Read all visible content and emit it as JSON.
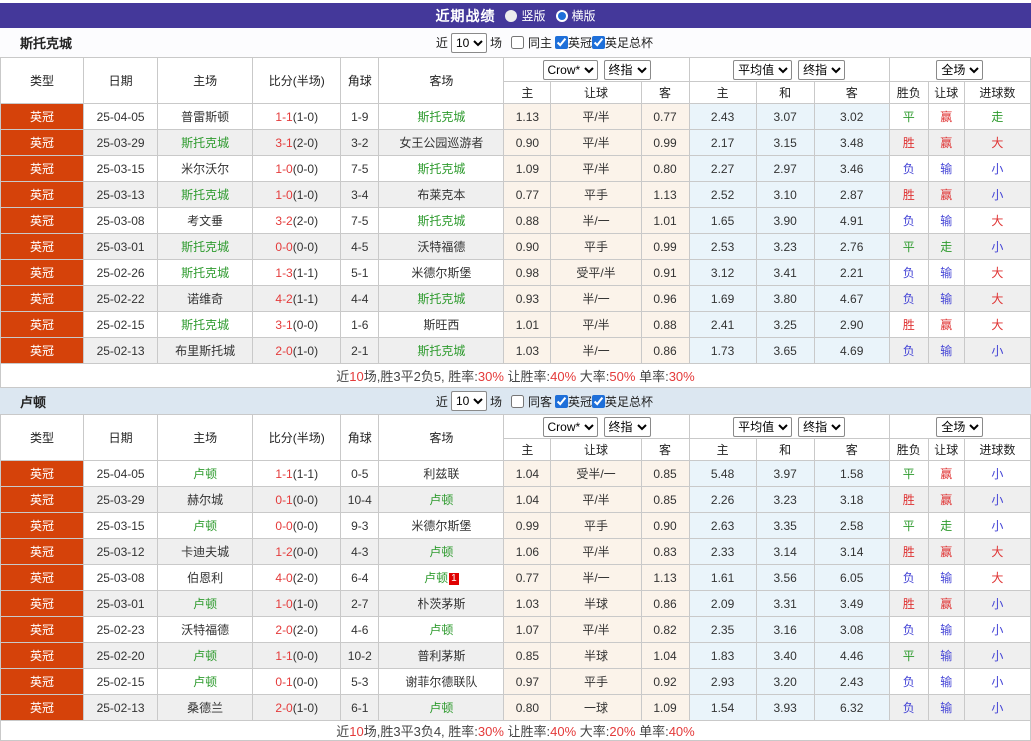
{
  "title_bar": {
    "title": "近期战绩",
    "options": [
      {
        "label": "竖版",
        "selected": false
      },
      {
        "label": "横版",
        "selected": true
      }
    ]
  },
  "table_head": {
    "cols": [
      "类型",
      "日期",
      "主场",
      "比分(半场)",
      "角球",
      "客场"
    ],
    "sub": [
      "主",
      "让球",
      "客",
      "主",
      "和",
      "客",
      "胜负",
      "让球",
      "进球数"
    ],
    "selects": {
      "book": "Crow*",
      "final1": "终指",
      "avg": "平均值",
      "final2": "终指",
      "full": "全场"
    }
  },
  "colors": {
    "accent": "#44389A",
    "league_badge": "#D5420A",
    "win_red": "#DF3232",
    "draw_green": "#2E9B2E",
    "lose_blue": "#4444D6",
    "handicap_bg": "#FBF3EA",
    "average_bg": "#EAF4FA"
  },
  "sections": [
    {
      "team": "斯托克城",
      "filter": {
        "near": "近",
        "count": "10",
        "unit": "场",
        "same": "同主",
        "same_checked": false,
        "leagues": [
          {
            "label": "英冠",
            "checked": true
          },
          {
            "label": "英足总杯",
            "checked": true
          }
        ]
      },
      "rows": [
        {
          "league": "英冠",
          "date": "25-04-05",
          "home": "普雷斯顿",
          "home_hl": false,
          "score": "1-1",
          "half": "(1-0)",
          "corner": "1-9",
          "away": "斯托克城",
          "away_hl": true,
          "odds": [
            "1.13",
            "平/半",
            "0.77"
          ],
          "europe": [
            "2.43",
            "3.07",
            "3.02"
          ],
          "results": [
            "平",
            "赢",
            "走"
          ]
        },
        {
          "league": "英冠",
          "date": "25-03-29",
          "home": "斯托克城",
          "home_hl": true,
          "score": "3-1",
          "half": "(2-0)",
          "corner": "3-2",
          "away": "女王公园巡游者",
          "away_hl": false,
          "odds": [
            "0.90",
            "平/半",
            "0.99"
          ],
          "europe": [
            "2.17",
            "3.15",
            "3.48"
          ],
          "results": [
            "胜",
            "赢",
            "大"
          ]
        },
        {
          "league": "英冠",
          "date": "25-03-15",
          "home": "米尔沃尔",
          "home_hl": false,
          "score": "1-0",
          "half": "(0-0)",
          "corner": "7-5",
          "away": "斯托克城",
          "away_hl": true,
          "odds": [
            "1.09",
            "平/半",
            "0.80"
          ],
          "europe": [
            "2.27",
            "2.97",
            "3.46"
          ],
          "results": [
            "负",
            "输",
            "小"
          ]
        },
        {
          "league": "英冠",
          "date": "25-03-13",
          "home": "斯托克城",
          "home_hl": true,
          "score": "1-0",
          "half": "(1-0)",
          "corner": "3-4",
          "away": "布莱克本",
          "away_hl": false,
          "odds": [
            "0.77",
            "平手",
            "1.13"
          ],
          "europe": [
            "2.52",
            "3.10",
            "2.87"
          ],
          "results": [
            "胜",
            "赢",
            "小"
          ]
        },
        {
          "league": "英冠",
          "date": "25-03-08",
          "home": "考文垂",
          "home_hl": false,
          "score": "3-2",
          "half": "(2-0)",
          "corner": "7-5",
          "away": "斯托克城",
          "away_hl": true,
          "odds": [
            "0.88",
            "半/一",
            "1.01"
          ],
          "europe": [
            "1.65",
            "3.90",
            "4.91"
          ],
          "results": [
            "负",
            "输",
            "大"
          ]
        },
        {
          "league": "英冠",
          "date": "25-03-01",
          "home": "斯托克城",
          "home_hl": true,
          "score": "0-0",
          "half": "(0-0)",
          "corner": "4-5",
          "away": "沃特福德",
          "away_hl": false,
          "odds": [
            "0.90",
            "平手",
            "0.99"
          ],
          "europe": [
            "2.53",
            "3.23",
            "2.76"
          ],
          "results": [
            "平",
            "走",
            "小"
          ]
        },
        {
          "league": "英冠",
          "date": "25-02-26",
          "home": "斯托克城",
          "home_hl": true,
          "score": "1-3",
          "half": "(1-1)",
          "corner": "5-1",
          "away": "米德尔斯堡",
          "away_hl": false,
          "odds": [
            "0.98",
            "受平/半",
            "0.91"
          ],
          "europe": [
            "3.12",
            "3.41",
            "2.21"
          ],
          "results": [
            "负",
            "输",
            "大"
          ]
        },
        {
          "league": "英冠",
          "date": "25-02-22",
          "home": "诺维奇",
          "home_hl": false,
          "score": "4-2",
          "half": "(1-1)",
          "corner": "4-4",
          "away": "斯托克城",
          "away_hl": true,
          "odds": [
            "0.93",
            "半/一",
            "0.96"
          ],
          "europe": [
            "1.69",
            "3.80",
            "4.67"
          ],
          "results": [
            "负",
            "输",
            "大"
          ]
        },
        {
          "league": "英冠",
          "date": "25-02-15",
          "home": "斯托克城",
          "home_hl": true,
          "score": "3-1",
          "half": "(0-0)",
          "corner": "1-6",
          "away": "斯旺西",
          "away_hl": false,
          "odds": [
            "1.01",
            "平/半",
            "0.88"
          ],
          "europe": [
            "2.41",
            "3.25",
            "2.90"
          ],
          "results": [
            "胜",
            "赢",
            "大"
          ]
        },
        {
          "league": "英冠",
          "date": "25-02-13",
          "home": "布里斯托城",
          "home_hl": false,
          "score": "2-0",
          "half": "(1-0)",
          "corner": "2-1",
          "away": "斯托克城",
          "away_hl": true,
          "odds": [
            "1.03",
            "半/一",
            "0.86"
          ],
          "europe": [
            "1.73",
            "3.65",
            "4.69"
          ],
          "results": [
            "负",
            "输",
            "小"
          ]
        }
      ],
      "summary": [
        [
          "近",
          0
        ],
        [
          "10",
          1
        ],
        [
          "场,胜3平2负5, 胜率:",
          0
        ],
        [
          "30%",
          1
        ],
        [
          " 让胜率:",
          0
        ],
        [
          "40%",
          1
        ],
        [
          " 大率:",
          0
        ],
        [
          "50%",
          1
        ],
        [
          " 单率:",
          0
        ],
        [
          "30%",
          1
        ]
      ]
    },
    {
      "team": "卢顿",
      "filter": {
        "near": "近",
        "count": "10",
        "unit": "场",
        "same": "同客",
        "same_checked": false,
        "leagues": [
          {
            "label": "英冠",
            "checked": true
          },
          {
            "label": "英足总杯",
            "checked": true
          }
        ]
      },
      "rows": [
        {
          "league": "英冠",
          "date": "25-04-05",
          "home": "卢顿",
          "home_hl": true,
          "score": "1-1",
          "half": "(1-1)",
          "corner": "0-5",
          "away": "利兹联",
          "away_hl": false,
          "odds": [
            "1.04",
            "受半/一",
            "0.85"
          ],
          "europe": [
            "5.48",
            "3.97",
            "1.58"
          ],
          "results": [
            "平",
            "赢",
            "小"
          ]
        },
        {
          "league": "英冠",
          "date": "25-03-29",
          "home": "赫尔城",
          "home_hl": false,
          "score": "0-1",
          "half": "(0-0)",
          "corner": "10-4",
          "away": "卢顿",
          "away_hl": true,
          "odds": [
            "1.04",
            "平/半",
            "0.85"
          ],
          "europe": [
            "2.26",
            "3.23",
            "3.18"
          ],
          "results": [
            "胜",
            "赢",
            "小"
          ]
        },
        {
          "league": "英冠",
          "date": "25-03-15",
          "home": "卢顿",
          "home_hl": true,
          "score": "0-0",
          "half": "(0-0)",
          "corner": "9-3",
          "away": "米德尔斯堡",
          "away_hl": false,
          "odds": [
            "0.99",
            "平手",
            "0.90"
          ],
          "europe": [
            "2.63",
            "3.35",
            "2.58"
          ],
          "results": [
            "平",
            "走",
            "小"
          ]
        },
        {
          "league": "英冠",
          "date": "25-03-12",
          "home": "卡迪夫城",
          "home_hl": false,
          "score": "1-2",
          "half": "(0-0)",
          "corner": "4-3",
          "away": "卢顿",
          "away_hl": true,
          "odds": [
            "1.06",
            "平/半",
            "0.83"
          ],
          "europe": [
            "2.33",
            "3.14",
            "3.14"
          ],
          "results": [
            "胜",
            "赢",
            "大"
          ]
        },
        {
          "league": "英冠",
          "date": "25-03-08",
          "home": "伯恩利",
          "home_hl": false,
          "score": "4-0",
          "half": "(2-0)",
          "corner": "6-4",
          "away": "卢顿",
          "away_hl": true,
          "away_card": "1",
          "odds": [
            "0.77",
            "半/一",
            "1.13"
          ],
          "europe": [
            "1.61",
            "3.56",
            "6.05"
          ],
          "results": [
            "负",
            "输",
            "大"
          ]
        },
        {
          "league": "英冠",
          "date": "25-03-01",
          "home": "卢顿",
          "home_hl": true,
          "score": "1-0",
          "half": "(1-0)",
          "corner": "2-7",
          "away": "朴茨茅斯",
          "away_hl": false,
          "odds": [
            "1.03",
            "半球",
            "0.86"
          ],
          "europe": [
            "2.09",
            "3.31",
            "3.49"
          ],
          "results": [
            "胜",
            "赢",
            "小"
          ]
        },
        {
          "league": "英冠",
          "date": "25-02-23",
          "home": "沃特福德",
          "home_hl": false,
          "score": "2-0",
          "half": "(2-0)",
          "corner": "4-6",
          "away": "卢顿",
          "away_hl": true,
          "odds": [
            "1.07",
            "平/半",
            "0.82"
          ],
          "europe": [
            "2.35",
            "3.16",
            "3.08"
          ],
          "results": [
            "负",
            "输",
            "小"
          ]
        },
        {
          "league": "英冠",
          "date": "25-02-20",
          "home": "卢顿",
          "home_hl": true,
          "score": "1-1",
          "half": "(0-0)",
          "corner": "10-2",
          "away": "普利茅斯",
          "away_hl": false,
          "odds": [
            "0.85",
            "半球",
            "1.04"
          ],
          "europe": [
            "1.83",
            "3.40",
            "4.46"
          ],
          "results": [
            "平",
            "输",
            "小"
          ]
        },
        {
          "league": "英冠",
          "date": "25-02-15",
          "home": "卢顿",
          "home_hl": true,
          "score": "0-1",
          "half": "(0-0)",
          "corner": "5-3",
          "away": "谢菲尔德联队",
          "away_hl": false,
          "odds": [
            "0.97",
            "平手",
            "0.92"
          ],
          "europe": [
            "2.93",
            "3.20",
            "2.43"
          ],
          "results": [
            "负",
            "输",
            "小"
          ]
        },
        {
          "league": "英冠",
          "date": "25-02-13",
          "home": "桑德兰",
          "home_hl": false,
          "score": "2-0",
          "half": "(1-0)",
          "corner": "6-1",
          "away": "卢顿",
          "away_hl": true,
          "odds": [
            "0.80",
            "一球",
            "1.09"
          ],
          "europe": [
            "1.54",
            "3.93",
            "6.32"
          ],
          "results": [
            "负",
            "输",
            "小"
          ]
        }
      ],
      "summary": [
        [
          "近",
          0
        ],
        [
          "10",
          1
        ],
        [
          "场,胜3平3负4, 胜率:",
          0
        ],
        [
          "30%",
          1
        ],
        [
          " 让胜率:",
          0
        ],
        [
          "40%",
          1
        ],
        [
          " 大率:",
          0
        ],
        [
          "20%",
          1
        ],
        [
          " 单率:",
          0
        ],
        [
          "40%",
          1
        ]
      ]
    }
  ]
}
